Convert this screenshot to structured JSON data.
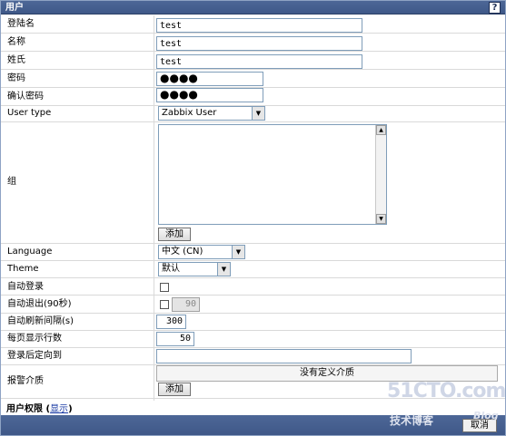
{
  "window": {
    "title": "用户",
    "help_icon": "?"
  },
  "fields": {
    "login": {
      "label": "登陆名",
      "value": "test"
    },
    "name": {
      "label": "名称",
      "value": "test"
    },
    "surname": {
      "label": "姓氏",
      "value": "test"
    },
    "password": {
      "label": "密码",
      "value": "●●●●"
    },
    "password_confirm": {
      "label": "确认密码",
      "value": "●●●●"
    },
    "user_type": {
      "label": "User type",
      "value": "Zabbix User"
    },
    "groups": {
      "label": "组",
      "add_label": "添加"
    },
    "language": {
      "label": "Language",
      "value": "中文 (CN)"
    },
    "theme": {
      "label": "Theme",
      "value": "默认"
    },
    "autologin": {
      "label": "自动登录"
    },
    "autologout": {
      "label": "自动退出(90秒)",
      "value": "90"
    },
    "refresh": {
      "label": "自动刷新间隔(s)",
      "value": "300"
    },
    "rows_per_page": {
      "label": "每页显示行数",
      "value": "50"
    },
    "url_after_login": {
      "label": "登录后定向到",
      "value": ""
    },
    "media": {
      "label": "报警介质",
      "empty_text": "没有定义介质",
      "add_label": "添加"
    }
  },
  "rights": {
    "label": "用户权限",
    "open": "(",
    "link": "显示",
    "close": ")"
  },
  "footer": {
    "cancel_label": "取消"
  },
  "watermark": {
    "line1": "51CTO.com",
    "line2": "技术博客",
    "line3": "Blog"
  }
}
